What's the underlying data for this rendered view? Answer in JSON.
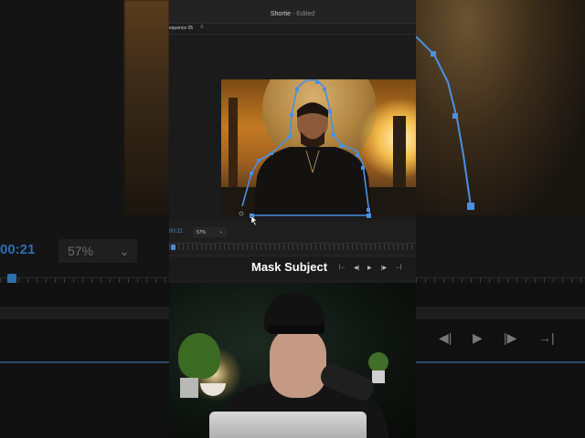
{
  "window": {
    "title": "Shortie",
    "status": "Edited"
  },
  "sequence": {
    "tab_label": "equence 05",
    "menu_icon": "hamburger-icon"
  },
  "timecode": "00:21",
  "background_timecode": "00:21",
  "zoom": {
    "value": "57%"
  },
  "caption": "Mask Subject",
  "transport": {
    "step_back_icon": "|←",
    "prev_frame_icon": "◀|",
    "play_icon": "▶",
    "next_frame_icon": "|▶",
    "step_forward_icon": "→|"
  },
  "colors": {
    "accent": "#4a8ad0",
    "mask_stroke": "#4a90e2",
    "panel": "#1e1e1e"
  }
}
